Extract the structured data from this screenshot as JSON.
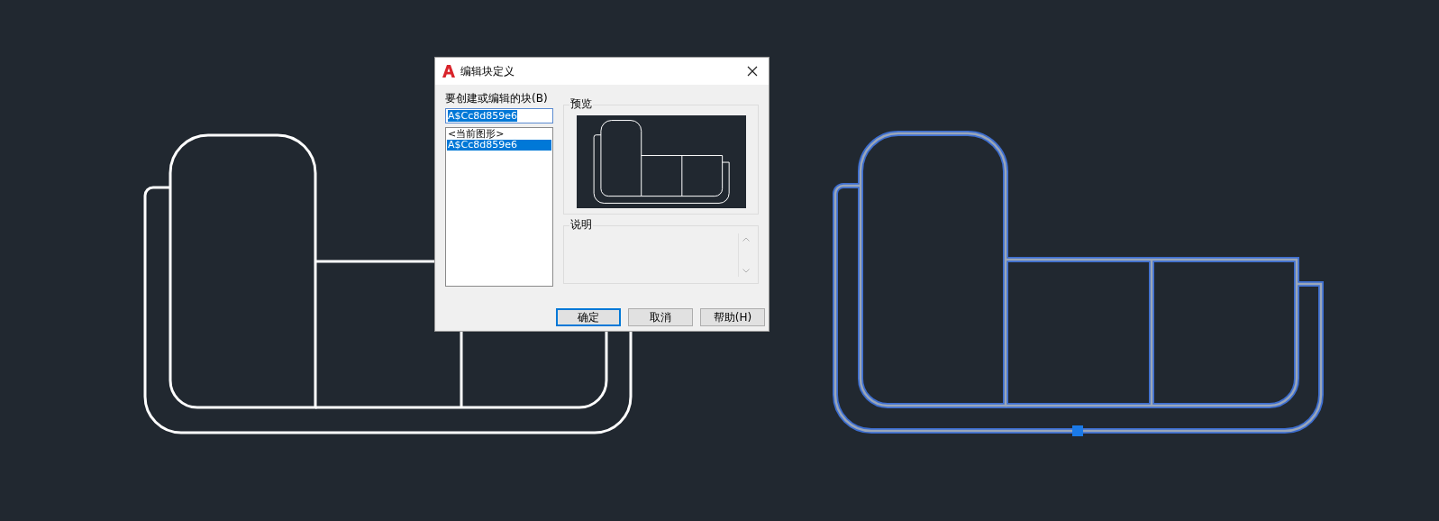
{
  "dialog": {
    "title": "编辑块定义",
    "block_label": "要创建或编辑的块(B)",
    "block_field": {
      "value": "A$Cc8d859e6",
      "text_selected": true
    },
    "block_list": [
      {
        "label": "<当前图形>",
        "selected": false
      },
      {
        "label": "A$Cc8d859e6",
        "selected": true
      }
    ],
    "preview_label": "预览",
    "description_label": "说明",
    "buttons": [
      {
        "label": "确定",
        "default": true
      },
      {
        "label": "取消",
        "default": false
      },
      {
        "label": "帮助(H)",
        "default": false
      }
    ]
  }
}
